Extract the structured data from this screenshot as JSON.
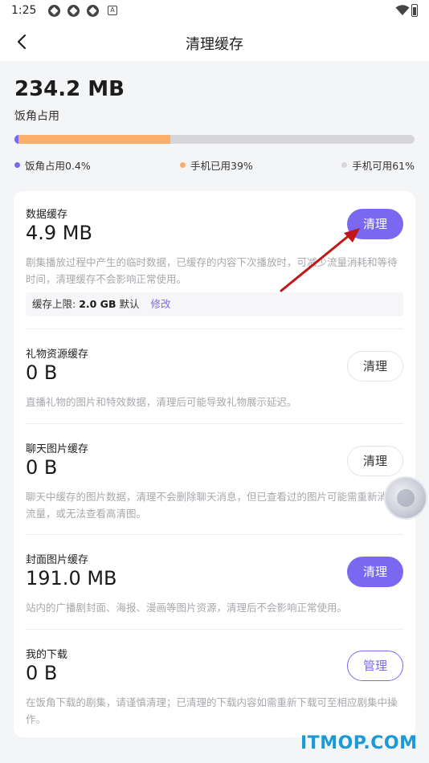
{
  "status": {
    "time": "1:25"
  },
  "nav": {
    "title": "清理缓存"
  },
  "summary": {
    "total": "234.2 MB",
    "caption": "饭角占用",
    "usage": {
      "app_fraction": 0.004,
      "phone_used_fraction": 0.39,
      "phone_free_fraction": 0.61
    },
    "legend": [
      {
        "label": "饭角占用0.4%",
        "color": "#7a68f0"
      },
      {
        "label": "手机已用39%",
        "color": "#f9ae6a"
      },
      {
        "label": "手机可用61%",
        "color": "#d6d6d9"
      }
    ]
  },
  "items": [
    {
      "title": "数据缓存",
      "size": "4.9 MB",
      "desc": "剧集播放过程中产生的临时数据，已缓存的内容下次播放时，可减少流量消耗和等待时间，清理缓存不会影响正常使用。",
      "button": "清理",
      "limit_prefix": "缓存上限: ",
      "limit_value": "2.0 GB",
      "limit_suffix": " 默认",
      "limit_edit": "修改"
    },
    {
      "title": "礼物资源缓存",
      "size": "0 B",
      "desc": "直播礼物的图片和特效数据，清理后可能导致礼物展示延迟。",
      "button": "清理"
    },
    {
      "title": "聊天图片缓存",
      "size": "0 B",
      "desc": "聊天中缓存的图片数据，清理不会删除聊天消息，但已查看过的图片可能需重新消耗流量，或无法查看高清图。",
      "button": "清理"
    },
    {
      "title": "封面图片缓存",
      "size": "191.0 MB",
      "desc": "站内的广播剧封面、海报、漫画等图片资源，清理后不会影响正常使用。",
      "button": "清理"
    },
    {
      "title": "我的下载",
      "size": "0 B",
      "desc": "在饭角下载的剧集，请谨慎清理；已清理的下载内容如需重新下载可至相应剧集中操作。",
      "button": "管理"
    }
  ],
  "watermark": "ITMOP.COM",
  "colors": {
    "accent": "#7a68f0",
    "orange": "#f9ae6a",
    "track": "#d6d6d9"
  }
}
